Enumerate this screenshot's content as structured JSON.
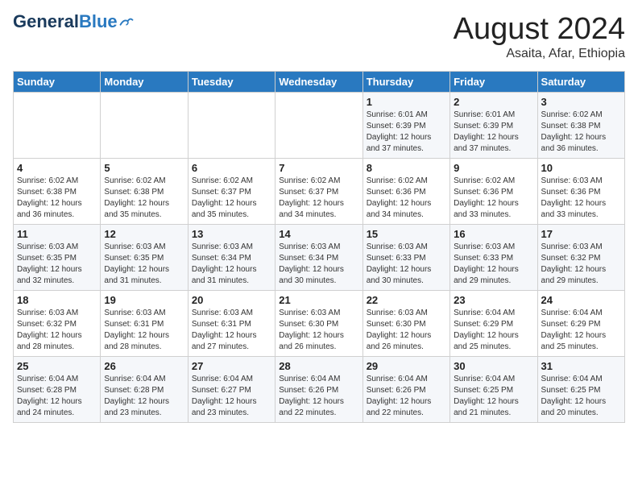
{
  "header": {
    "logo_general": "General",
    "logo_blue": "Blue",
    "month": "August 2024",
    "location": "Asaita, Afar, Ethiopia"
  },
  "weekdays": [
    "Sunday",
    "Monday",
    "Tuesday",
    "Wednesday",
    "Thursday",
    "Friday",
    "Saturday"
  ],
  "weeks": [
    [
      {
        "day": "",
        "info": ""
      },
      {
        "day": "",
        "info": ""
      },
      {
        "day": "",
        "info": ""
      },
      {
        "day": "",
        "info": ""
      },
      {
        "day": "1",
        "info": "Sunrise: 6:01 AM\nSunset: 6:39 PM\nDaylight: 12 hours\nand 37 minutes."
      },
      {
        "day": "2",
        "info": "Sunrise: 6:01 AM\nSunset: 6:39 PM\nDaylight: 12 hours\nand 37 minutes."
      },
      {
        "day": "3",
        "info": "Sunrise: 6:02 AM\nSunset: 6:38 PM\nDaylight: 12 hours\nand 36 minutes."
      }
    ],
    [
      {
        "day": "4",
        "info": "Sunrise: 6:02 AM\nSunset: 6:38 PM\nDaylight: 12 hours\nand 36 minutes."
      },
      {
        "day": "5",
        "info": "Sunrise: 6:02 AM\nSunset: 6:38 PM\nDaylight: 12 hours\nand 35 minutes."
      },
      {
        "day": "6",
        "info": "Sunrise: 6:02 AM\nSunset: 6:37 PM\nDaylight: 12 hours\nand 35 minutes."
      },
      {
        "day": "7",
        "info": "Sunrise: 6:02 AM\nSunset: 6:37 PM\nDaylight: 12 hours\nand 34 minutes."
      },
      {
        "day": "8",
        "info": "Sunrise: 6:02 AM\nSunset: 6:36 PM\nDaylight: 12 hours\nand 34 minutes."
      },
      {
        "day": "9",
        "info": "Sunrise: 6:02 AM\nSunset: 6:36 PM\nDaylight: 12 hours\nand 33 minutes."
      },
      {
        "day": "10",
        "info": "Sunrise: 6:03 AM\nSunset: 6:36 PM\nDaylight: 12 hours\nand 33 minutes."
      }
    ],
    [
      {
        "day": "11",
        "info": "Sunrise: 6:03 AM\nSunset: 6:35 PM\nDaylight: 12 hours\nand 32 minutes."
      },
      {
        "day": "12",
        "info": "Sunrise: 6:03 AM\nSunset: 6:35 PM\nDaylight: 12 hours\nand 31 minutes."
      },
      {
        "day": "13",
        "info": "Sunrise: 6:03 AM\nSunset: 6:34 PM\nDaylight: 12 hours\nand 31 minutes."
      },
      {
        "day": "14",
        "info": "Sunrise: 6:03 AM\nSunset: 6:34 PM\nDaylight: 12 hours\nand 30 minutes."
      },
      {
        "day": "15",
        "info": "Sunrise: 6:03 AM\nSunset: 6:33 PM\nDaylight: 12 hours\nand 30 minutes."
      },
      {
        "day": "16",
        "info": "Sunrise: 6:03 AM\nSunset: 6:33 PM\nDaylight: 12 hours\nand 29 minutes."
      },
      {
        "day": "17",
        "info": "Sunrise: 6:03 AM\nSunset: 6:32 PM\nDaylight: 12 hours\nand 29 minutes."
      }
    ],
    [
      {
        "day": "18",
        "info": "Sunrise: 6:03 AM\nSunset: 6:32 PM\nDaylight: 12 hours\nand 28 minutes."
      },
      {
        "day": "19",
        "info": "Sunrise: 6:03 AM\nSunset: 6:31 PM\nDaylight: 12 hours\nand 28 minutes."
      },
      {
        "day": "20",
        "info": "Sunrise: 6:03 AM\nSunset: 6:31 PM\nDaylight: 12 hours\nand 27 minutes."
      },
      {
        "day": "21",
        "info": "Sunrise: 6:03 AM\nSunset: 6:30 PM\nDaylight: 12 hours\nand 26 minutes."
      },
      {
        "day": "22",
        "info": "Sunrise: 6:03 AM\nSunset: 6:30 PM\nDaylight: 12 hours\nand 26 minutes."
      },
      {
        "day": "23",
        "info": "Sunrise: 6:04 AM\nSunset: 6:29 PM\nDaylight: 12 hours\nand 25 minutes."
      },
      {
        "day": "24",
        "info": "Sunrise: 6:04 AM\nSunset: 6:29 PM\nDaylight: 12 hours\nand 25 minutes."
      }
    ],
    [
      {
        "day": "25",
        "info": "Sunrise: 6:04 AM\nSunset: 6:28 PM\nDaylight: 12 hours\nand 24 minutes."
      },
      {
        "day": "26",
        "info": "Sunrise: 6:04 AM\nSunset: 6:28 PM\nDaylight: 12 hours\nand 23 minutes."
      },
      {
        "day": "27",
        "info": "Sunrise: 6:04 AM\nSunset: 6:27 PM\nDaylight: 12 hours\nand 23 minutes."
      },
      {
        "day": "28",
        "info": "Sunrise: 6:04 AM\nSunset: 6:26 PM\nDaylight: 12 hours\nand 22 minutes."
      },
      {
        "day": "29",
        "info": "Sunrise: 6:04 AM\nSunset: 6:26 PM\nDaylight: 12 hours\nand 22 minutes."
      },
      {
        "day": "30",
        "info": "Sunrise: 6:04 AM\nSunset: 6:25 PM\nDaylight: 12 hours\nand 21 minutes."
      },
      {
        "day": "31",
        "info": "Sunrise: 6:04 AM\nSunset: 6:25 PM\nDaylight: 12 hours\nand 20 minutes."
      }
    ]
  ]
}
